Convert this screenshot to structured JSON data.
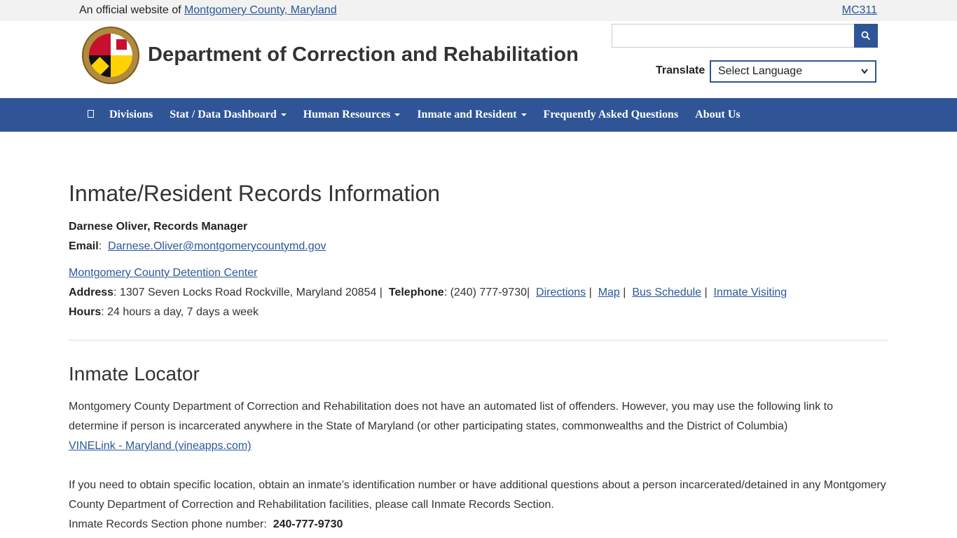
{
  "topbar": {
    "official_prefix": "An official website of",
    "official_link": "Montgomery County, Maryland",
    "mc311": "MC311"
  },
  "header": {
    "site_title": "Department of Correction and Rehabilitation",
    "search_icon": "search-icon",
    "translate_label": "Translate",
    "language_select": "Select Language"
  },
  "nav": {
    "home_icon": "home-icon",
    "items": [
      {
        "label": "Divisions"
      },
      {
        "label": "Stat / Data Dashboard"
      },
      {
        "label": "Human Resources"
      },
      {
        "label": "Inmate and Resident"
      },
      {
        "label": "Frequently Asked Questions"
      },
      {
        "label": "About Us"
      }
    ]
  },
  "records": {
    "title": "Inmate/Resident Records Information",
    "manager": "Darnese Oliver, Records Manager",
    "email_label": "Email",
    "email": "Darnese.Oliver@montgomerycountymd.gov",
    "facility_link": "Montgomery County Detention Center",
    "address_label": "Address",
    "address": "1307 Seven Locks Road Rockville, Maryland 20854",
    "telephone_label": "Telephone",
    "telephone": "(240) 777-9730",
    "directions": "Directions",
    "map": "Map",
    "bus_schedule": "Bus Schedule",
    "inmate_visiting": "Inmate Visiting",
    "hours_label": "Hours",
    "hours": "24 hours a day, 7 days a week"
  },
  "locator": {
    "title": "Inmate Locator",
    "para1_line1": "Montgomery County Department of Correction and Rehabilitation does not have an automated list of offenders.  However, you may use the following link to",
    "para1_line2": "determine if person is incarcerated anywhere in the State of Maryland (or other participating states, commonwealths and the District of Columbia)",
    "vine_link": "VINELink - Maryland (vineapps.com)",
    "para2_line1": "If you need to obtain specific location, obtain an inmate’s identification number or have additional questions about a person incarcerated/detained in any Montgomery",
    "para2_line2": "County Department of Correction and Rehabilitation facilities, please call Inmate Records Section.",
    "phone_label": "Inmate Records Section phone number:",
    "phone": "240-777-9730"
  }
}
